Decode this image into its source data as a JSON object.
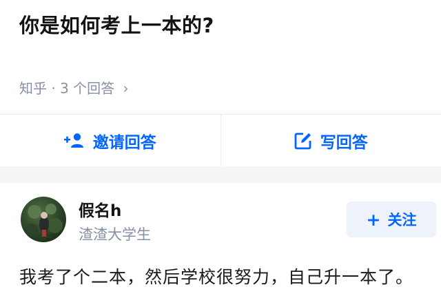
{
  "question": {
    "title": "你是如何考上一本的?"
  },
  "meta": {
    "source": "知乎",
    "separator": "·",
    "answer_count": "3 个回答",
    "chevron": "›"
  },
  "actions": {
    "invite_label": "邀请回答",
    "invite_icon": "add-user-icon",
    "write_label": "写回答",
    "write_icon": "edit-icon",
    "accent": "#0066ff"
  },
  "answer": {
    "author_name": "假名h",
    "author_bio": "渣渣大学生",
    "follow_label": "关注",
    "follow_plus": "+",
    "text": "我考了个二本，然后学校很努力，自己升一本了。"
  }
}
